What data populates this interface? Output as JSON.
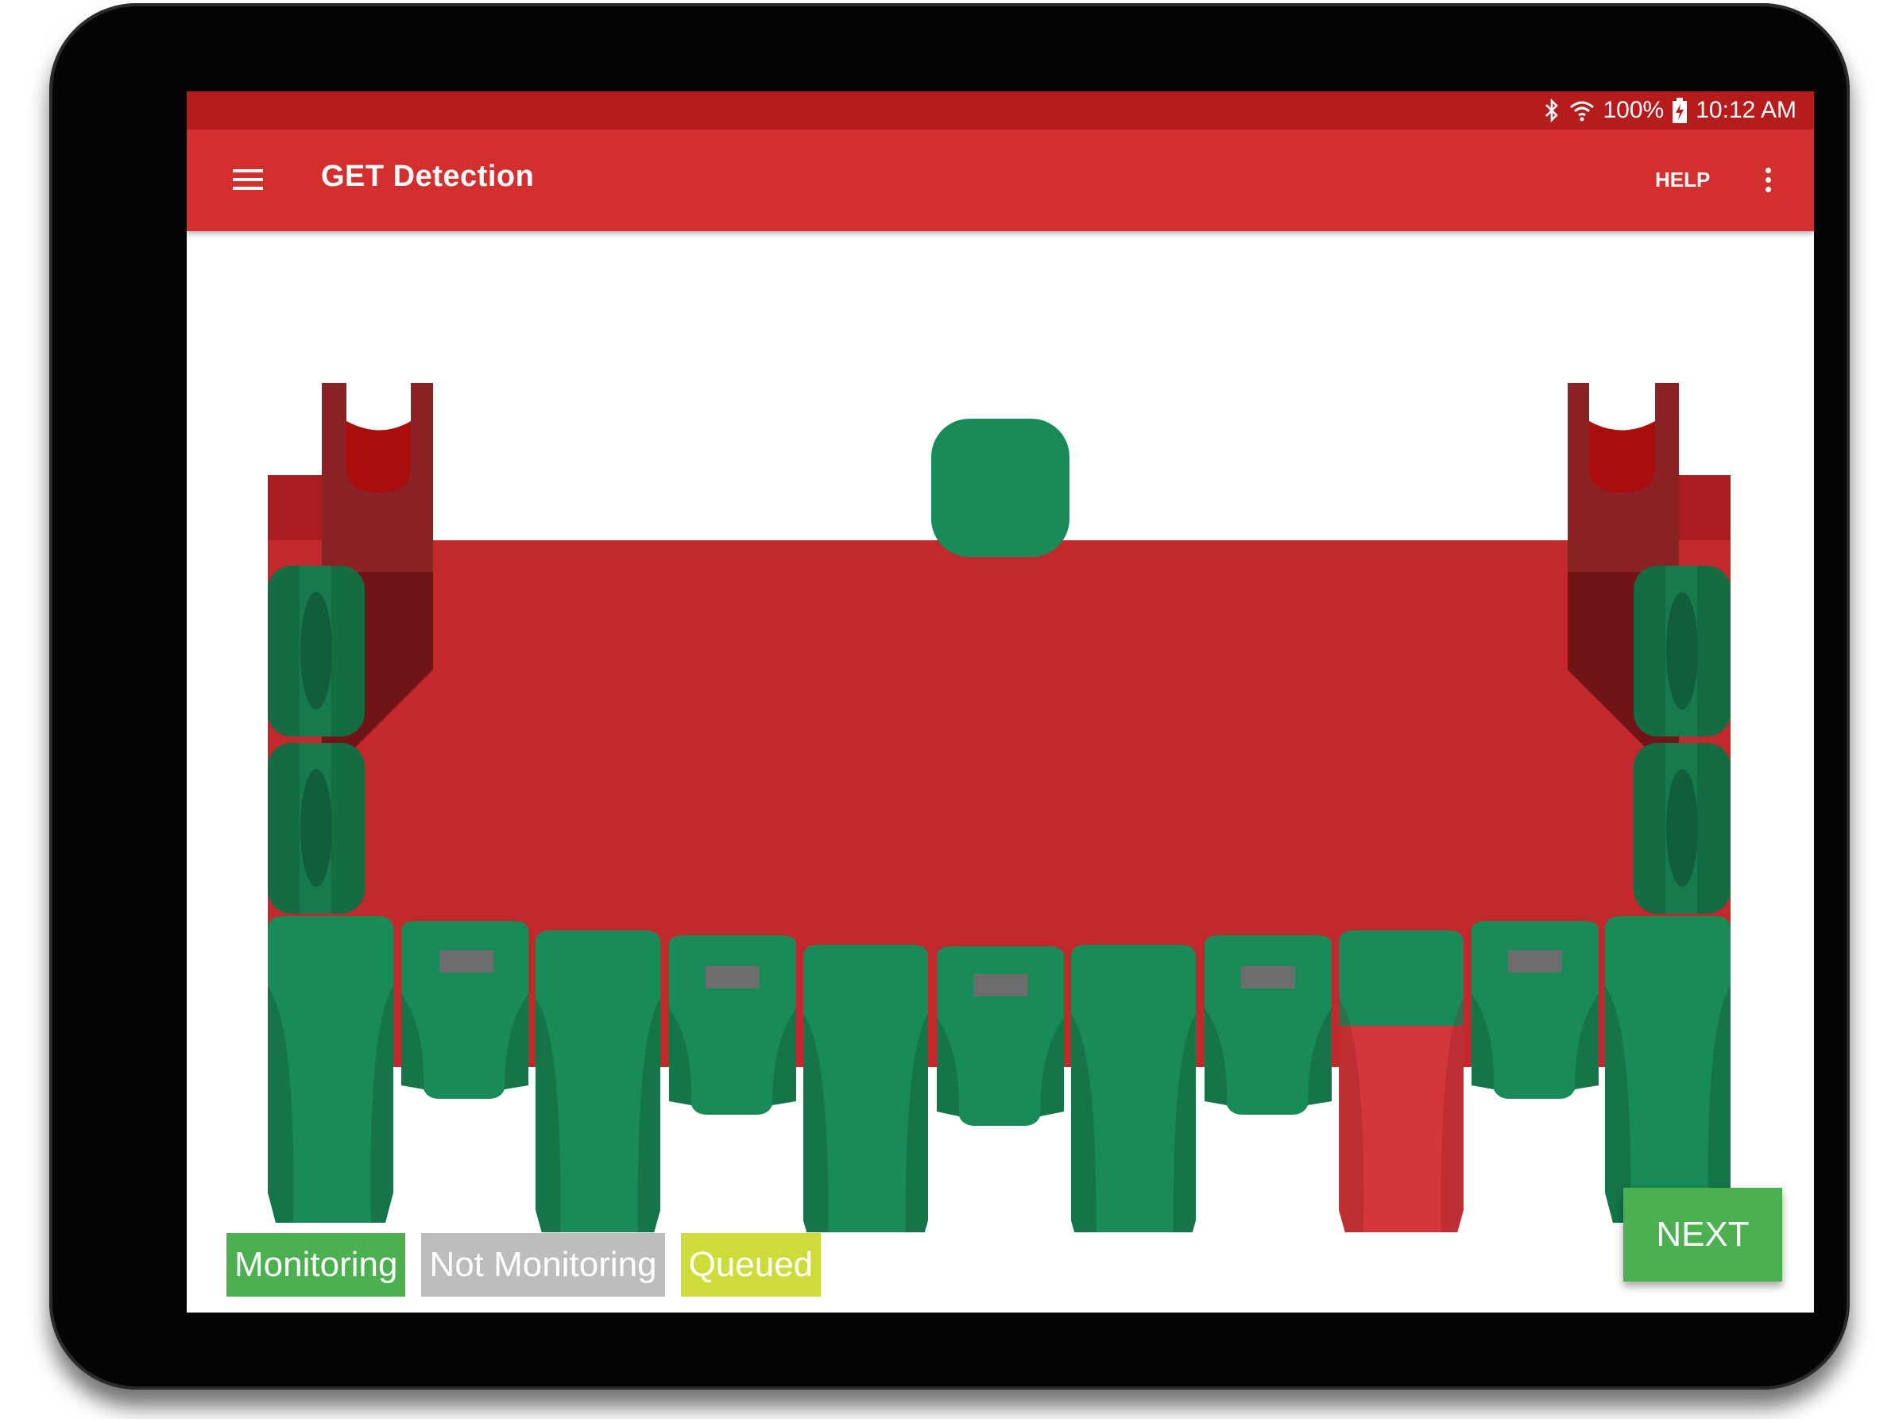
{
  "status_bar": {
    "battery": "100%",
    "time": "10:12 AM",
    "icons": [
      "bluetooth-icon",
      "wifi-icon",
      "battery-charging-icon"
    ]
  },
  "app_bar": {
    "title": "GET Detection",
    "help_label": "HELP",
    "menu_icon": "hamburger-menu-icon",
    "overflow_icon": "more-vert-icon"
  },
  "bucket": {
    "colors": {
      "body": "#c3282d",
      "body_dark": "#a91d21",
      "corner_dark": "#8a2226",
      "corner_darker": "#701416",
      "lug": "#ab0c0c",
      "tooth": "#198b58",
      "tooth_dark": "#146c43",
      "tooth_alert": "#d3363b",
      "slot": "#6d6d6d"
    },
    "teeth": [
      {
        "id": 1,
        "type": "tooth",
        "status": "monitoring"
      },
      {
        "id": 2,
        "type": "shroud",
        "status": "monitoring"
      },
      {
        "id": 3,
        "type": "tooth",
        "status": "monitoring"
      },
      {
        "id": 4,
        "type": "shroud",
        "status": "monitoring"
      },
      {
        "id": 5,
        "type": "tooth",
        "status": "monitoring"
      },
      {
        "id": 6,
        "type": "shroud",
        "status": "monitoring"
      },
      {
        "id": 7,
        "type": "tooth",
        "status": "monitoring"
      },
      {
        "id": 8,
        "type": "shroud",
        "status": "monitoring"
      },
      {
        "id": 9,
        "type": "tooth",
        "status": "missing"
      },
      {
        "id": 10,
        "type": "shroud",
        "status": "monitoring"
      },
      {
        "id": 11,
        "type": "tooth",
        "status": "monitoring"
      }
    ],
    "wing_shrouds": [
      {
        "side": "left",
        "count": 2,
        "status": "monitoring"
      },
      {
        "side": "right",
        "count": 2,
        "status": "monitoring"
      }
    ],
    "top_sensor": {
      "status": "monitoring"
    }
  },
  "legend": [
    {
      "label": "Monitoring",
      "color": "#4caf50"
    },
    {
      "label": "Not Monitoring",
      "color": "#bdbdbd"
    },
    {
      "label": "Queued",
      "color": "#cddc39"
    }
  ],
  "next_button": {
    "label": "NEXT",
    "color": "#4caf50"
  }
}
